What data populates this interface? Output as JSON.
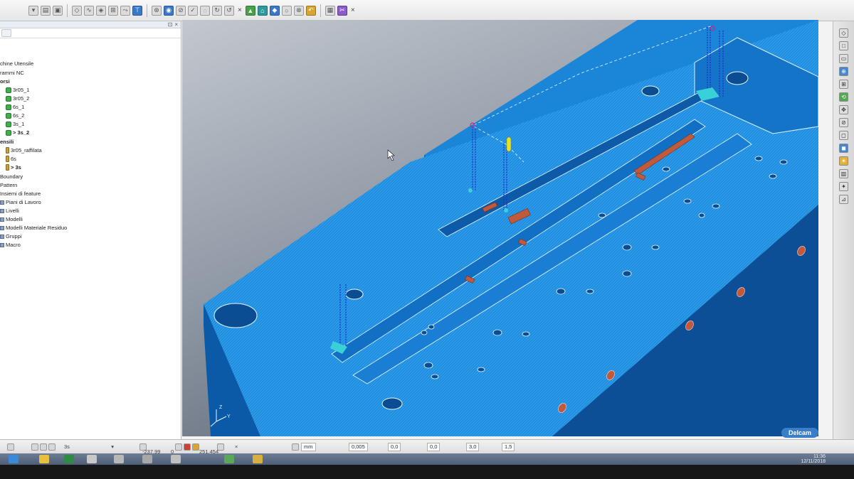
{
  "toolbar": {
    "close_label": "×",
    "close_label_2": "×"
  },
  "explorer": {
    "items": [
      {
        "label": "chine Utensile"
      },
      {
        "label": "rammi NC"
      },
      {
        "label": "orsi"
      },
      {
        "label": "3r05_1"
      },
      {
        "label": "3r05_2"
      },
      {
        "label": "6s_1"
      },
      {
        "label": "6s_2"
      },
      {
        "label": "3s_1"
      },
      {
        "label": "> 3s_2"
      },
      {
        "label": "ensili"
      },
      {
        "label": "3r05_raffilata"
      },
      {
        "label": "6s"
      },
      {
        "label": "> 3s"
      },
      {
        "label": "Boundary"
      },
      {
        "label": "Pattern"
      },
      {
        "label": "Insiemi di feature"
      },
      {
        "label": "Piani di Lavoro"
      },
      {
        "label": "Livelli"
      },
      {
        "label": "Modelli"
      },
      {
        "label": "Modelli Materiale Residuo"
      },
      {
        "label": "Gruppi"
      },
      {
        "label": "Macro"
      }
    ]
  },
  "statusbar": {
    "tool_name": "3s",
    "coord_x": "-237,99",
    "coord_y": "0",
    "coord_z": "251,454",
    "units": "mm",
    "tolerance": "0,005",
    "thickness": "0,0",
    "axial_thickness": "0,0",
    "stepover": "3,0",
    "stepdown": "1,5"
  },
  "brand": {
    "name": "Delcam"
  },
  "taskbar": {
    "time": "11:36",
    "date": "12/11/2018"
  },
  "colors": {
    "model_blue": "#1e8fe0",
    "model_dark": "#0d5fb0",
    "toolpath_blue": "#1a2fd0",
    "stock_red": "#c05a3c",
    "accent_cyan": "#3ad0d8"
  }
}
